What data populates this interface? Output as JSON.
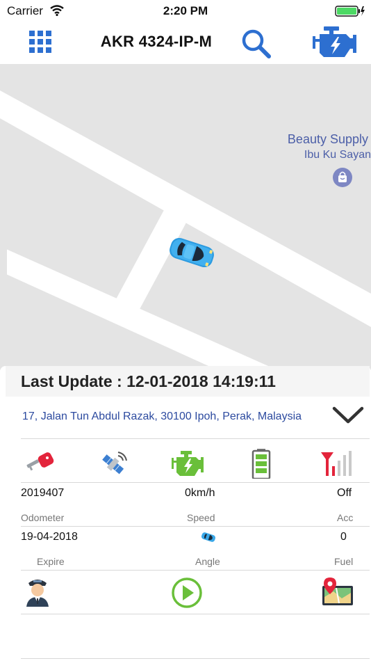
{
  "status_bar": {
    "carrier": "Carrier",
    "time": "2:20 PM"
  },
  "nav": {
    "title": "AKR 4324-IP-M",
    "icons": [
      "grid-menu-icon",
      "search-icon",
      "engine-icon"
    ],
    "accent_color": "#2d6fd0"
  },
  "map": {
    "poi_name": "Beauty Supply",
    "poi_sub": "Ibu Ku Sayan",
    "poi_color": "#4c5fa8",
    "car_color": "#3aa8e8"
  },
  "panel": {
    "last_update": "Last Update : 12-01-2018 14:19:11",
    "address": "17, Jalan Tun Abdul Razak, 30100 Ipoh, Perak, Malaysia",
    "status_icons": [
      "key-icon",
      "gps-satellite-icon",
      "engine-status-icon",
      "battery-icon",
      "signal-strength-icon"
    ],
    "stats_row1": [
      {
        "value": "2019407",
        "label": "Odometer"
      },
      {
        "value": "0km/h",
        "label": "Speed"
      },
      {
        "value": "Off",
        "label": "Acc"
      }
    ],
    "stats_row2": [
      {
        "value": "19-04-2018",
        "label": "Expire"
      },
      {
        "value": "",
        "label": "Angle"
      },
      {
        "value": "0",
        "label": "Fuel"
      }
    ],
    "actions": [
      "driver-icon",
      "play-icon",
      "map-location-icon"
    ]
  }
}
